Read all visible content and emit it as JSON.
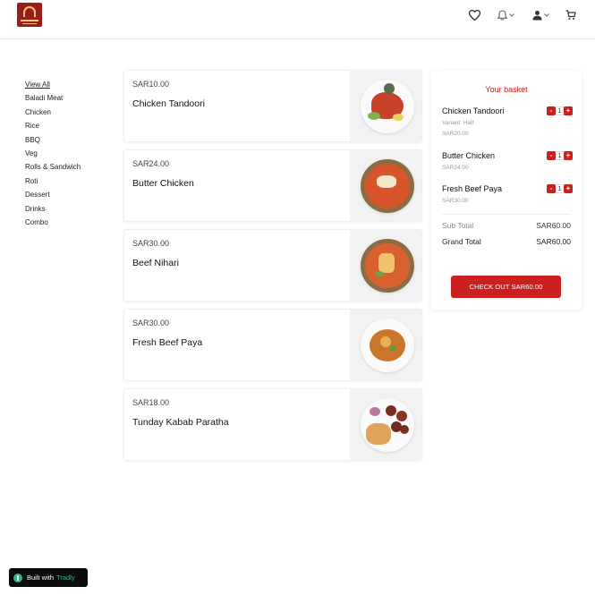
{
  "header": {
    "logo_icon": "restaurant-logo-icon",
    "icons": [
      "heart-icon",
      "bell-icon",
      "user-icon",
      "cart-icon"
    ]
  },
  "sidebar": {
    "categories": [
      {
        "label": "View All",
        "active": true
      },
      {
        "label": "Baladi Meat"
      },
      {
        "label": "Chicken"
      },
      {
        "label": "Rice"
      },
      {
        "label": "BBQ"
      },
      {
        "label": "Veg"
      },
      {
        "label": "Rolls & Sandwich"
      },
      {
        "label": "Roti"
      },
      {
        "label": "Dessert"
      },
      {
        "label": "Drinks"
      },
      {
        "label": "Combo"
      }
    ]
  },
  "products": [
    {
      "price": "SAR10.00",
      "name": "Chicken Tandoori",
      "image": "chicken-tandoori-photo"
    },
    {
      "price": "SAR24.00",
      "name": "Butter Chicken",
      "image": "butter-chicken-photo"
    },
    {
      "price": "SAR30.00",
      "name": "Beef Nihari",
      "image": "beef-nihari-photo"
    },
    {
      "price": "SAR30.00",
      "name": "Fresh Beef Paya",
      "image": "fresh-beef-paya-photo"
    },
    {
      "price": "SAR18.00",
      "name": "Tunday Kabab Paratha",
      "image": "tunday-kabab-paratha-photo"
    }
  ],
  "basket": {
    "title": "Your basket",
    "items": [
      {
        "name": "Chicken Tandoori",
        "variant": "Variant: Half",
        "price": "SAR20.00",
        "qty": "1"
      },
      {
        "name": "Butter Chicken",
        "price": "SAR24.00",
        "qty": "1"
      },
      {
        "name": "Fresh Beef Paya",
        "price": "SAR30.00",
        "qty": "1"
      }
    ],
    "minus": "-",
    "plus": "+",
    "subtotal_label": "Sub Total",
    "subtotal_value": "SAR60.00",
    "grandtotal_label": "Grand Total",
    "grandtotal_value": "SAR60.00",
    "checkout_label": "CHECK OUT SAR60.00"
  },
  "badge": {
    "prefix": "Built with",
    "brand": "Tradly"
  },
  "colors": {
    "accent": "#cc1f1f",
    "brand_green": "#2fb886",
    "logo_bg": "#9b1c1c"
  }
}
